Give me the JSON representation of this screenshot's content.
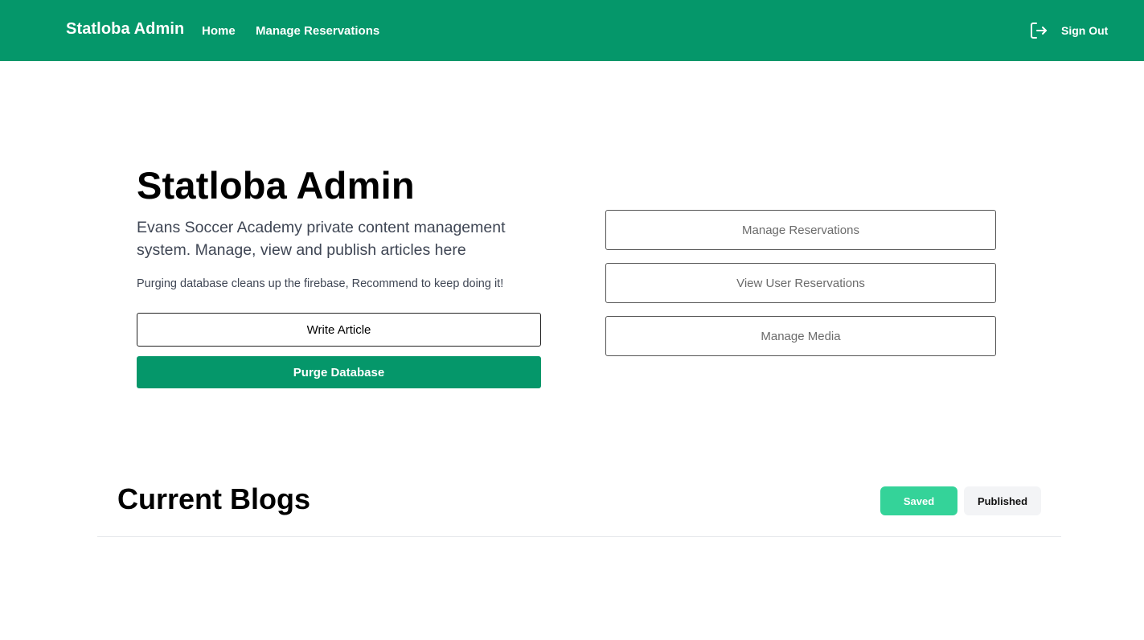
{
  "navbar": {
    "brand": "Statloba Admin",
    "links": [
      {
        "label": "Home"
      },
      {
        "label": "Manage Reservations"
      }
    ],
    "signout_label": "Sign Out",
    "signout_icon": "sign-out-icon",
    "background_color": "#05976a"
  },
  "hero": {
    "title": "Statloba Admin",
    "description": "Evans Soccer Academy private content management system. Manage, view and publish articles here",
    "note": "Purging database cleans up the firebase, Recommend to keep doing it!",
    "write_button": "Write Article",
    "purge_button": "Purge Database"
  },
  "side_actions": [
    {
      "label": "Manage Reservations"
    },
    {
      "label": "View User Reservations"
    },
    {
      "label": "Manage Media"
    }
  ],
  "blogs": {
    "title": "Current Blogs",
    "tabs": [
      {
        "label": "Saved",
        "active": true
      },
      {
        "label": "Published",
        "active": false
      }
    ]
  },
  "colors": {
    "primary": "#05976a",
    "saved_tab": "#34d399",
    "published_tab": "#f3f4f6"
  }
}
